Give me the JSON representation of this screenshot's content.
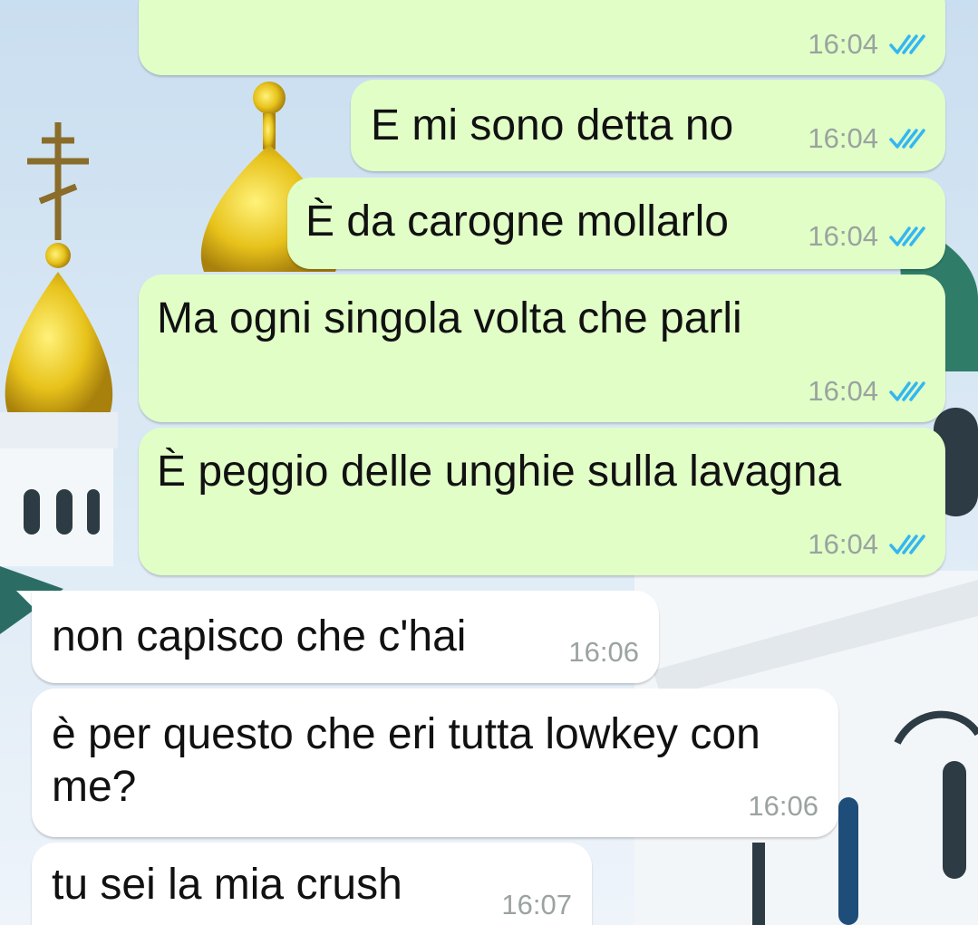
{
  "colors": {
    "outgoing_bubble": "#e1fec7",
    "incoming_bubble": "#ffffff",
    "timestamp": "#9aa3a0",
    "read_ticks": "#34b7f1"
  },
  "icons": {
    "read_receipt": "double-check-icon"
  },
  "messages": [
    {
      "direction": "out",
      "text": "",
      "time": "16:04",
      "read": true
    },
    {
      "direction": "out",
      "text": "E mi sono detta no",
      "time": "16:04",
      "read": true
    },
    {
      "direction": "out",
      "text": "È da carogne mollarlo",
      "time": "16:04",
      "read": true
    },
    {
      "direction": "out",
      "text": "Ma ogni singola volta che parli",
      "time": "16:04",
      "read": true
    },
    {
      "direction": "out",
      "text": "È peggio delle unghie sulla lavagna",
      "time": "16:04",
      "read": true
    },
    {
      "direction": "in",
      "text": "non capisco che c'hai",
      "time": "16:06"
    },
    {
      "direction": "in",
      "text": "è per questo che eri tutta lowkey con me?",
      "time": "16:06"
    },
    {
      "direction": "in",
      "text": "tu sei la mia crush",
      "time": "16:07"
    }
  ]
}
